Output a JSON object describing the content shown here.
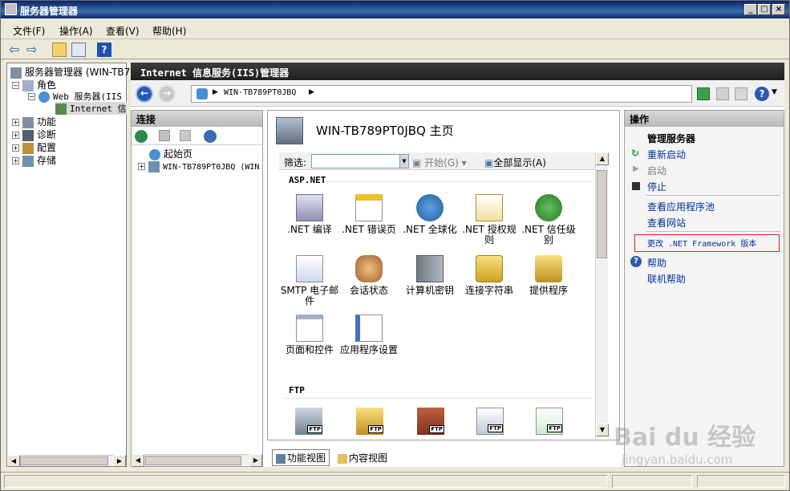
{
  "window": {
    "title": "服务器管理器"
  },
  "menu": [
    "文件(F)",
    "操作(A)",
    "查看(V)",
    "帮助(H)"
  ],
  "tree": {
    "root": "服务器管理器 (WIN-TB7",
    "roles": "角色",
    "web": "Web 服务器(IIS",
    "iis": "Internet 信",
    "features": "功能",
    "diag": "诊断",
    "config": "配置",
    "storage": "存储"
  },
  "iis": {
    "title": "Internet 信息服务(IIS)管理器",
    "address": "WIN-TB789PT0JBQ"
  },
  "connections": {
    "title": "连接",
    "start": "起始页",
    "server": "WIN-TB789PT0JBQ (WIN"
  },
  "home": {
    "title": "WIN-TB789PT0JBQ 主页",
    "filter_label": "筛选:",
    "start": "开始(G)",
    "showall": "全部显示(A)"
  },
  "groups": {
    "aspnet": "ASP.NET",
    "ftp": "FTP"
  },
  "features": [
    {
      "label": ".NET 编译"
    },
    {
      "label": ".NET 错误页"
    },
    {
      "label": ".NET 全球化"
    },
    {
      "label": ".NET 授权规则"
    },
    {
      "label": ".NET 信任级别"
    },
    {
      "label": "SMTP 电子邮件"
    },
    {
      "label": "会话状态"
    },
    {
      "label": "计算机密钥"
    },
    {
      "label": "连接字符串"
    },
    {
      "label": "提供程序"
    },
    {
      "label": "页面和控件"
    },
    {
      "label": "应用程序设置"
    }
  ],
  "ftp_icons": [
    "FTP",
    "FTP",
    "FTP",
    "FTP",
    "FTP"
  ],
  "tabs": {
    "feature": "功能视图",
    "content": "内容视图"
  },
  "actions": {
    "title": "操作",
    "manage": "管理服务器",
    "restart": "重新启动",
    "start": "启动",
    "stop": "停止",
    "apppools": "查看应用程序池",
    "sites": "查看网站",
    "netfw": "更改 .NET Framework 版本",
    "help": "帮助",
    "onlinehelp": "联机帮助"
  },
  "watermark": {
    "brand": "Bai du 经验",
    "url": "jingyan.baidu.com"
  }
}
